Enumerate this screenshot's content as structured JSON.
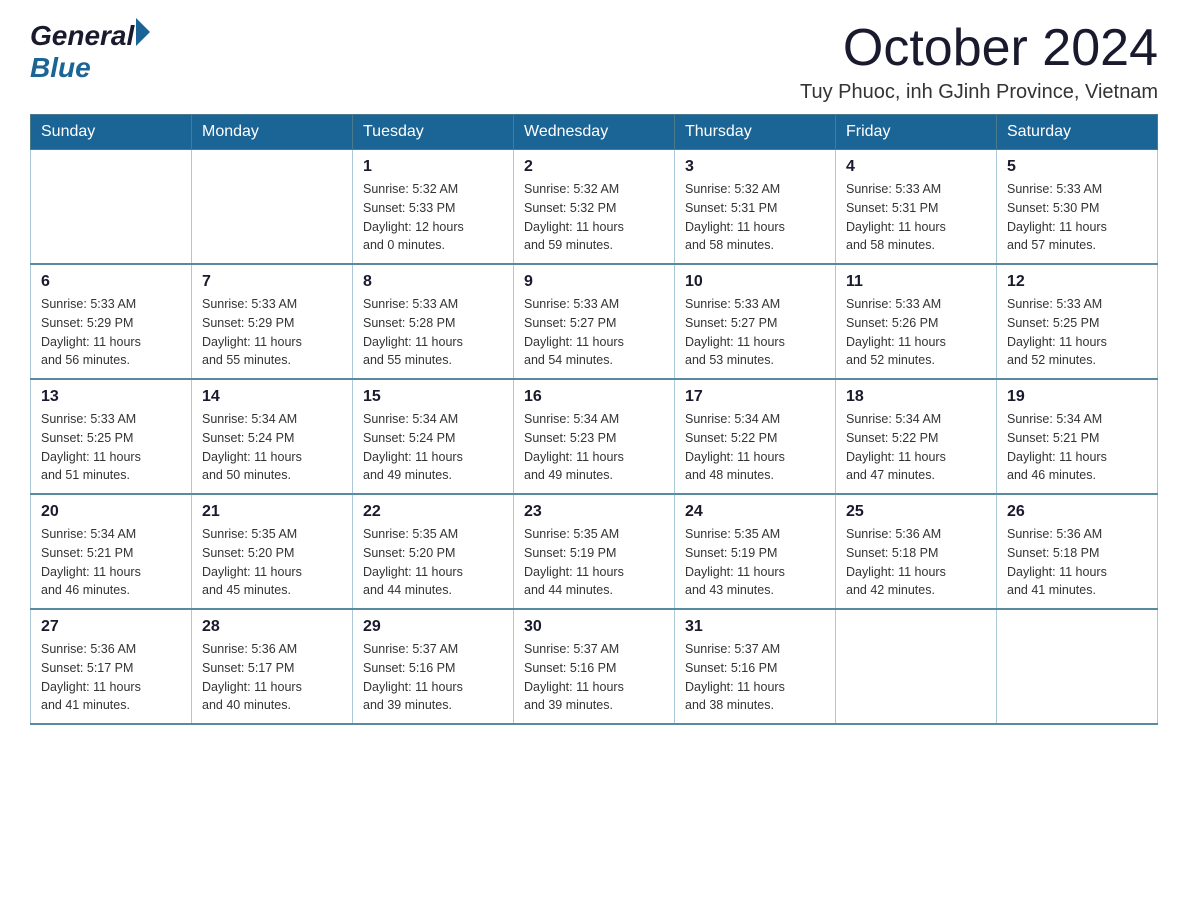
{
  "logo": {
    "general": "General",
    "blue": "Blue"
  },
  "title": "October 2024",
  "subtitle": "Tuy Phuoc, inh GJinh Province, Vietnam",
  "weekdays": [
    "Sunday",
    "Monday",
    "Tuesday",
    "Wednesday",
    "Thursday",
    "Friday",
    "Saturday"
  ],
  "weeks": [
    [
      {
        "day": "",
        "info": ""
      },
      {
        "day": "",
        "info": ""
      },
      {
        "day": "1",
        "info": "Sunrise: 5:32 AM\nSunset: 5:33 PM\nDaylight: 12 hours\nand 0 minutes."
      },
      {
        "day": "2",
        "info": "Sunrise: 5:32 AM\nSunset: 5:32 PM\nDaylight: 11 hours\nand 59 minutes."
      },
      {
        "day": "3",
        "info": "Sunrise: 5:32 AM\nSunset: 5:31 PM\nDaylight: 11 hours\nand 58 minutes."
      },
      {
        "day": "4",
        "info": "Sunrise: 5:33 AM\nSunset: 5:31 PM\nDaylight: 11 hours\nand 58 minutes."
      },
      {
        "day": "5",
        "info": "Sunrise: 5:33 AM\nSunset: 5:30 PM\nDaylight: 11 hours\nand 57 minutes."
      }
    ],
    [
      {
        "day": "6",
        "info": "Sunrise: 5:33 AM\nSunset: 5:29 PM\nDaylight: 11 hours\nand 56 minutes."
      },
      {
        "day": "7",
        "info": "Sunrise: 5:33 AM\nSunset: 5:29 PM\nDaylight: 11 hours\nand 55 minutes."
      },
      {
        "day": "8",
        "info": "Sunrise: 5:33 AM\nSunset: 5:28 PM\nDaylight: 11 hours\nand 55 minutes."
      },
      {
        "day": "9",
        "info": "Sunrise: 5:33 AM\nSunset: 5:27 PM\nDaylight: 11 hours\nand 54 minutes."
      },
      {
        "day": "10",
        "info": "Sunrise: 5:33 AM\nSunset: 5:27 PM\nDaylight: 11 hours\nand 53 minutes."
      },
      {
        "day": "11",
        "info": "Sunrise: 5:33 AM\nSunset: 5:26 PM\nDaylight: 11 hours\nand 52 minutes."
      },
      {
        "day": "12",
        "info": "Sunrise: 5:33 AM\nSunset: 5:25 PM\nDaylight: 11 hours\nand 52 minutes."
      }
    ],
    [
      {
        "day": "13",
        "info": "Sunrise: 5:33 AM\nSunset: 5:25 PM\nDaylight: 11 hours\nand 51 minutes."
      },
      {
        "day": "14",
        "info": "Sunrise: 5:34 AM\nSunset: 5:24 PM\nDaylight: 11 hours\nand 50 minutes."
      },
      {
        "day": "15",
        "info": "Sunrise: 5:34 AM\nSunset: 5:24 PM\nDaylight: 11 hours\nand 49 minutes."
      },
      {
        "day": "16",
        "info": "Sunrise: 5:34 AM\nSunset: 5:23 PM\nDaylight: 11 hours\nand 49 minutes."
      },
      {
        "day": "17",
        "info": "Sunrise: 5:34 AM\nSunset: 5:22 PM\nDaylight: 11 hours\nand 48 minutes."
      },
      {
        "day": "18",
        "info": "Sunrise: 5:34 AM\nSunset: 5:22 PM\nDaylight: 11 hours\nand 47 minutes."
      },
      {
        "day": "19",
        "info": "Sunrise: 5:34 AM\nSunset: 5:21 PM\nDaylight: 11 hours\nand 46 minutes."
      }
    ],
    [
      {
        "day": "20",
        "info": "Sunrise: 5:34 AM\nSunset: 5:21 PM\nDaylight: 11 hours\nand 46 minutes."
      },
      {
        "day": "21",
        "info": "Sunrise: 5:35 AM\nSunset: 5:20 PM\nDaylight: 11 hours\nand 45 minutes."
      },
      {
        "day": "22",
        "info": "Sunrise: 5:35 AM\nSunset: 5:20 PM\nDaylight: 11 hours\nand 44 minutes."
      },
      {
        "day": "23",
        "info": "Sunrise: 5:35 AM\nSunset: 5:19 PM\nDaylight: 11 hours\nand 44 minutes."
      },
      {
        "day": "24",
        "info": "Sunrise: 5:35 AM\nSunset: 5:19 PM\nDaylight: 11 hours\nand 43 minutes."
      },
      {
        "day": "25",
        "info": "Sunrise: 5:36 AM\nSunset: 5:18 PM\nDaylight: 11 hours\nand 42 minutes."
      },
      {
        "day": "26",
        "info": "Sunrise: 5:36 AM\nSunset: 5:18 PM\nDaylight: 11 hours\nand 41 minutes."
      }
    ],
    [
      {
        "day": "27",
        "info": "Sunrise: 5:36 AM\nSunset: 5:17 PM\nDaylight: 11 hours\nand 41 minutes."
      },
      {
        "day": "28",
        "info": "Sunrise: 5:36 AM\nSunset: 5:17 PM\nDaylight: 11 hours\nand 40 minutes."
      },
      {
        "day": "29",
        "info": "Sunrise: 5:37 AM\nSunset: 5:16 PM\nDaylight: 11 hours\nand 39 minutes."
      },
      {
        "day": "30",
        "info": "Sunrise: 5:37 AM\nSunset: 5:16 PM\nDaylight: 11 hours\nand 39 minutes."
      },
      {
        "day": "31",
        "info": "Sunrise: 5:37 AM\nSunset: 5:16 PM\nDaylight: 11 hours\nand 38 minutes."
      },
      {
        "day": "",
        "info": ""
      },
      {
        "day": "",
        "info": ""
      }
    ]
  ]
}
